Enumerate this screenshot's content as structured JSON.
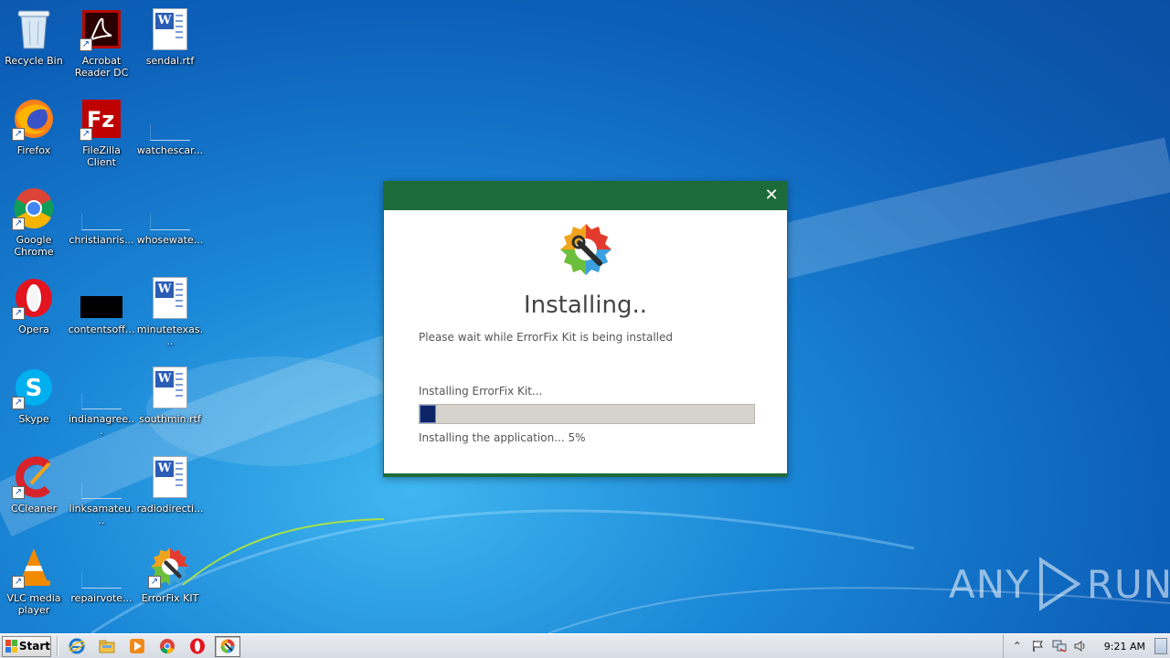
{
  "desktop": {
    "icons": [
      {
        "id": "recycle-bin",
        "label": "Recycle Bin"
      },
      {
        "id": "acrobat",
        "label": "Acrobat Reader DC"
      },
      {
        "id": "sendal",
        "label": "sendal.rtf"
      },
      {
        "id": "firefox",
        "label": "Firefox"
      },
      {
        "id": "filezilla",
        "label": "FileZilla Client"
      },
      {
        "id": "watchescar",
        "label": "watchescar..."
      },
      {
        "id": "chrome",
        "label": "Google Chrome"
      },
      {
        "id": "christianris",
        "label": "christianris..."
      },
      {
        "id": "whosewate",
        "label": "whosewate..."
      },
      {
        "id": "opera",
        "label": "Opera"
      },
      {
        "id": "contentsoff",
        "label": "contentsoff..."
      },
      {
        "id": "minutetexas",
        "label": "minutetexas..."
      },
      {
        "id": "skype",
        "label": "Skype"
      },
      {
        "id": "indianagree",
        "label": "indianagree..."
      },
      {
        "id": "southmin",
        "label": "southmin.rtf"
      },
      {
        "id": "ccleaner",
        "label": "CCleaner"
      },
      {
        "id": "linksamateu",
        "label": "linksamateu..."
      },
      {
        "id": "radiodirecti",
        "label": "radiodirecti..."
      },
      {
        "id": "vlc",
        "label": "VLC media player"
      },
      {
        "id": "repairvote",
        "label": "repairvote..."
      },
      {
        "id": "errorfix",
        "label": "ErrorFix KIT"
      }
    ]
  },
  "installer": {
    "close_glyph": "✕",
    "heading": "Installing..",
    "subtitle": "Please wait while ErrorFix Kit is being installed",
    "step": "Installing ErrorFix Kit...",
    "status": "Installing the application... 5%",
    "progress_fraction": 0.05,
    "colors": {
      "titlebar": "#1d6b3b",
      "progress_fill": "#0d2466",
      "progress_track": "#d6d2cc"
    }
  },
  "watermark": {
    "left": "ANY",
    "right": "RUN"
  },
  "taskbar": {
    "start_label": "Start",
    "pinned": [
      "ie-icon",
      "explorer-icon",
      "media-player-icon",
      "chrome-icon",
      "opera-icon",
      "errorfix-icon"
    ],
    "clock": "9:21 AM"
  }
}
